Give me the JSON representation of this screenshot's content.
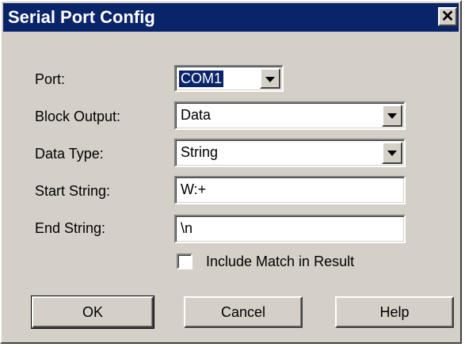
{
  "window": {
    "title": "Serial Port Config",
    "close_glyph": "✕"
  },
  "form": {
    "port": {
      "label": "Port:",
      "value": "COM1"
    },
    "block_output": {
      "label": "Block Output:",
      "value": "Data"
    },
    "data_type": {
      "label": "Data Type:",
      "value": "String"
    },
    "start_string": {
      "label": "Start String:",
      "value": "W:+"
    },
    "end_string": {
      "label": "End String:",
      "value": "\\n"
    },
    "include_match": {
      "label": "Include Match in Result",
      "checked": false
    }
  },
  "buttons": {
    "ok": "OK",
    "cancel": "Cancel",
    "help": "Help"
  },
  "colors": {
    "titlebar": "#0a246a",
    "face": "#d4d0c8",
    "selection": "#0a246a"
  }
}
